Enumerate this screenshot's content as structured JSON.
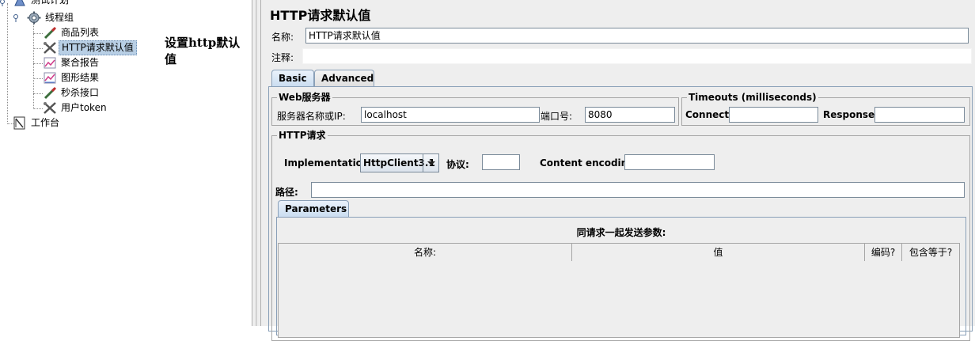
{
  "tree": {
    "items": [
      {
        "label": "测试计划",
        "icon": "test-plan-icon"
      },
      {
        "label": "线程组",
        "icon": "thread-group-icon"
      },
      {
        "label": "商品列表",
        "icon": "http-sampler-icon"
      },
      {
        "label": "HTTP请求默认值",
        "icon": "config-element-icon"
      },
      {
        "label": "聚合报告",
        "icon": "aggregate-report-icon"
      },
      {
        "label": "图形结果",
        "icon": "graph-results-icon"
      },
      {
        "label": "秒杀接口",
        "icon": "http-sampler-icon"
      },
      {
        "label": "用户token",
        "icon": "config-element-icon"
      },
      {
        "label": "工作台",
        "icon": "workbench-icon"
      }
    ],
    "selected": "HTTP请求默认值"
  },
  "annotation": "设置http默认值",
  "panel": {
    "title": "HTTP请求默认值",
    "name_label": "名称:",
    "name_value": "HTTP请求默认值",
    "comment_label": "注释:",
    "comment_value": "",
    "tabs": [
      "Basic",
      "Advanced"
    ],
    "active_tab": "Basic",
    "web_server": {
      "legend": "Web服务器",
      "server_label": "服务器名称或IP:",
      "server_value": "localhost",
      "port_label": "端口号:",
      "port_value": "8080"
    },
    "timeouts": {
      "legend": "Timeouts (milliseconds)",
      "connect_label": "Connect:",
      "connect_value": "",
      "response_label": "Response:",
      "response_value": ""
    },
    "http_request": {
      "legend": "HTTP请求",
      "implementation_label": "Implementation:",
      "implementation_value": "HttpClient3.1",
      "protocol_label": "协议:",
      "protocol_value": "",
      "encoding_label": "Content encoding:",
      "encoding_value": "",
      "path_label": "路径:",
      "path_value": ""
    },
    "parameters": {
      "tab_label": "Parameters",
      "caption": "同请求一起发送参数:",
      "columns": [
        "名称:",
        "值",
        "编码?",
        "包含等于?"
      ]
    }
  },
  "colors": {
    "panel_bg": "#eeeeee",
    "selection_bg": "#b8cfe5",
    "tab_active": "#c9dcf0"
  }
}
